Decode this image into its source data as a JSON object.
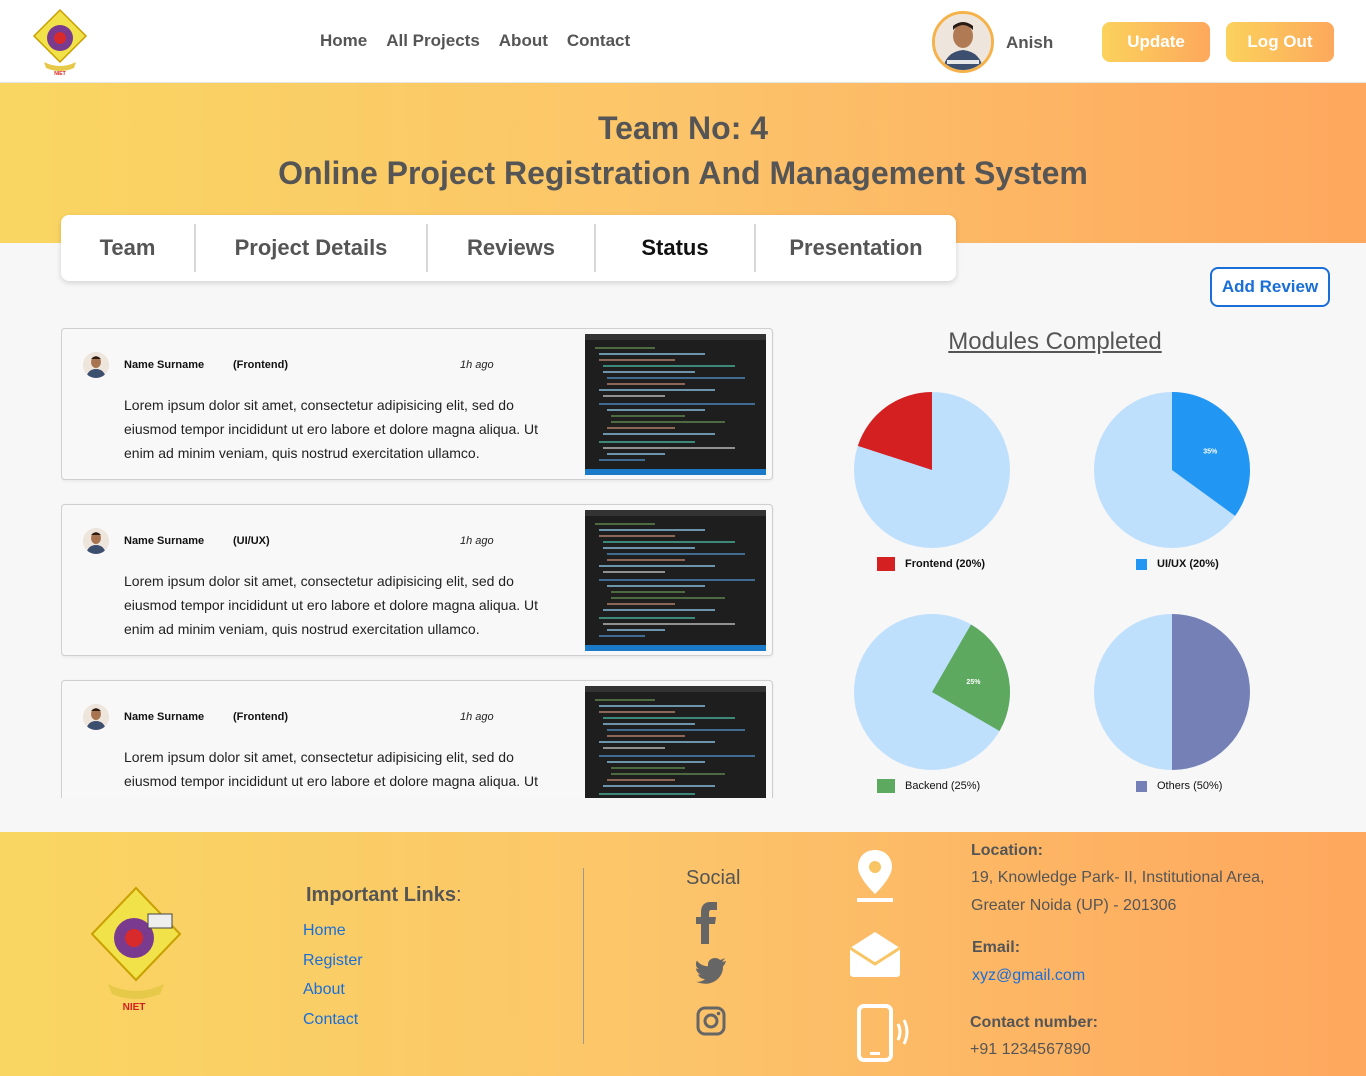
{
  "header": {
    "nav": [
      "Home",
      "All Projects",
      "About",
      "Contact"
    ],
    "username": "Anish",
    "update_label": "Update",
    "logout_label": "Log Out",
    "logo_text": "NIET"
  },
  "banner": {
    "team_no": "Team No: 4",
    "project_title": "Online Project Registration And Management System"
  },
  "tabs": [
    "Team",
    "Project Details",
    "Reviews",
    "Status",
    "Presentation"
  ],
  "active_tab": "Status",
  "add_review_label": "Add Review",
  "reviews": [
    {
      "name": "Name Surname",
      "role": "(Frontend)",
      "time": "1h ago",
      "text": "Lorem ipsum dolor sit amet, consectetur adipisicing elit, sed do eiusmod tempor incididunt ut ero labore et dolore magna aliqua. Ut enim ad minim veniam, quis nostrud exercitation ullamco."
    },
    {
      "name": "Name Surname",
      "role": "(UI/UX)",
      "time": "1h ago",
      "text": "Lorem ipsum dolor sit amet, consectetur adipisicing elit, sed do eiusmod tempor incididunt ut ero labore et dolore magna aliqua. Ut enim ad minim veniam, quis nostrud exercitation ullamco."
    },
    {
      "name": "Name Surname",
      "role": "(Frontend)",
      "time": "1h ago",
      "text": "Lorem ipsum dolor sit amet, consectetur adipisicing elit, sed do eiusmod tempor incididunt ut ero labore et dolore magna aliqua. Ut enim ad minim veniam, quis nostrud exercitation ullamco."
    }
  ],
  "chart_data": {
    "type": "pie",
    "title": "Modules Completed",
    "series": [
      {
        "name": "Frontend (20%)",
        "value": 20,
        "color": "#d42020",
        "rest_color": "#bfe0fc",
        "label": ""
      },
      {
        "name": "UI/UX (20%)",
        "value": 35,
        "color": "#2196f3",
        "rest_color": "#bfe0fc",
        "label": "35%"
      },
      {
        "name": "Backend (25%)",
        "value": 25,
        "color": "#5da95f",
        "rest_color": "#bfe0fc",
        "label": "25%"
      },
      {
        "name": "Others (50%)",
        "value": 50,
        "color": "#7580b6",
        "rest_color": "#bfe0fc",
        "label": ""
      }
    ]
  },
  "footer": {
    "links_title": "Important Links",
    "links_colon": ":",
    "links": [
      "Home",
      "Register",
      "About",
      "Contact"
    ],
    "social_title": "Social",
    "location_label": "Location:",
    "location_line1": "19, Knowledge Park- II, Institutional Area,",
    "location_line2": "Greater Noida (UP) - 201306",
    "email_label": "Email:",
    "email_value": "xyz@gmail.com",
    "phone_label": "Contact number:",
    "phone_value": "+91 1234567890"
  },
  "colors": {
    "accent_blue": "#1a6ed8",
    "gradient_start": "#f9d662",
    "gradient_end": "#fea75e"
  }
}
